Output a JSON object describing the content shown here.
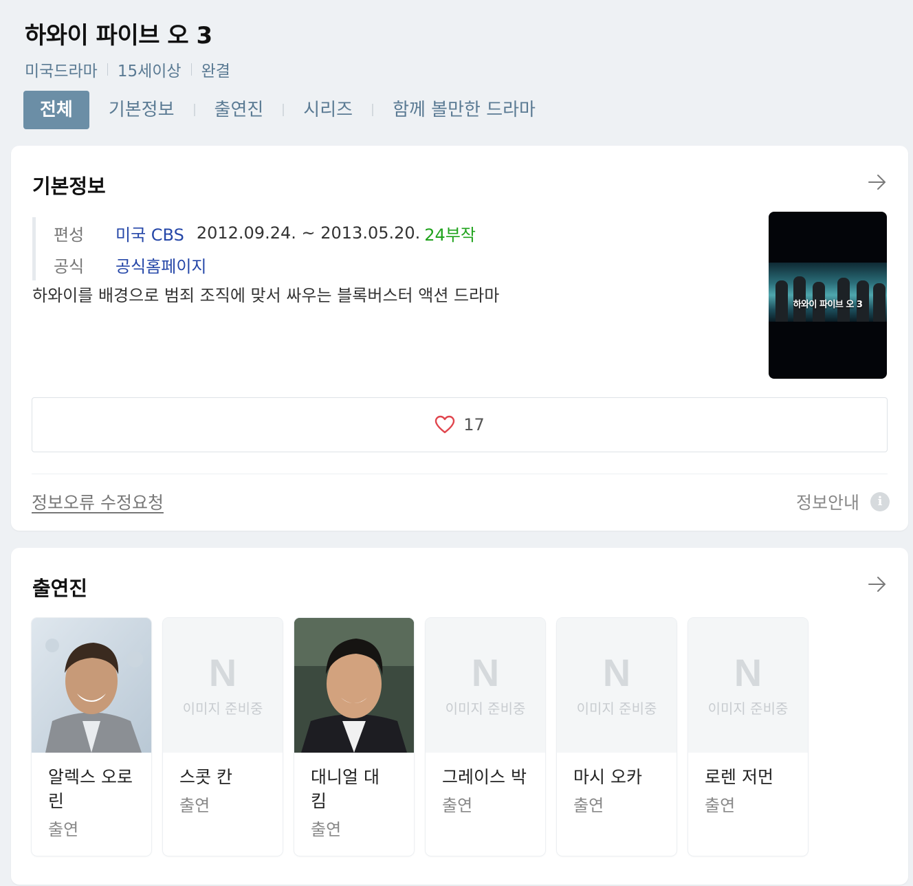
{
  "show": {
    "title": "하와이 파이브 오 3",
    "meta": [
      "미국드라마",
      "15세이상",
      "완결"
    ]
  },
  "tabs": [
    {
      "label": "전체",
      "active": true
    },
    {
      "label": "기본정보"
    },
    {
      "label": "출연진"
    },
    {
      "label": "시리즈"
    },
    {
      "label": "함께 볼만한 드라마"
    }
  ],
  "basic_info": {
    "heading": "기본정보",
    "broadcast_label": "편성",
    "broadcast_network": "미국 CBS",
    "broadcast_dates": "2012.09.24. ~ 2013.05.20.",
    "episodes": "24부작",
    "official_label": "공식",
    "official_link": "공식홈페이지",
    "description": "하와이를 배경으로 범죄 조직에 맞서 싸우는 블록버스터 액션 드라마",
    "poster_text": "하와이 파이브 오 3",
    "like_count": "17",
    "report_link": "정보오류 수정요청",
    "info_guide": "정보안내",
    "info_icon": "i"
  },
  "cast": {
    "heading": "출연진",
    "placeholder_logo": "N",
    "placeholder_text": "이미지 준비중",
    "members": [
      {
        "name": "알렉스 오로린",
        "role": "출연",
        "has_photo": true
      },
      {
        "name": "스콧 칸",
        "role": "출연",
        "has_photo": false
      },
      {
        "name": "대니얼 대 킴",
        "role": "출연",
        "has_photo": true
      },
      {
        "name": "그레이스 박",
        "role": "출연",
        "has_photo": false
      },
      {
        "name": "마시 오카",
        "role": "출연",
        "has_photo": false
      },
      {
        "name": "로렌 저먼",
        "role": "출연",
        "has_photo": false
      }
    ]
  },
  "colors": {
    "accent": "#6b8ea6",
    "link": "#2547a8",
    "episodes": "#20a31d",
    "heart": "#e0454d"
  }
}
